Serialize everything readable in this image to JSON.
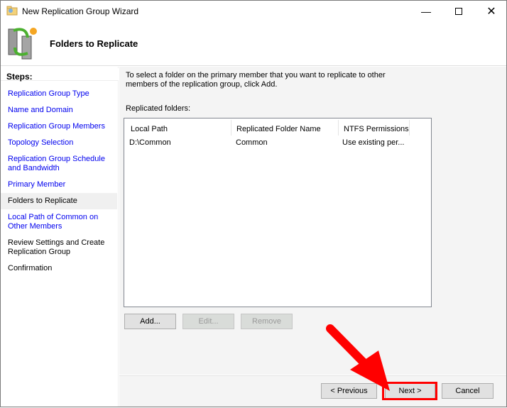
{
  "window": {
    "title": "New Replication Group Wizard",
    "controls": [
      "minimize",
      "maximize",
      "close"
    ]
  },
  "header": {
    "title": "Folders to Replicate",
    "icon": "replication-servers-icon"
  },
  "steps": {
    "heading": "Steps:",
    "items": [
      {
        "label": "Replication Group Type",
        "state": "link"
      },
      {
        "label": "Name and Domain",
        "state": "link"
      },
      {
        "label": "Replication Group Members",
        "state": "link"
      },
      {
        "label": "Topology Selection",
        "state": "link"
      },
      {
        "label": "Replication Group Schedule and Bandwidth",
        "state": "link"
      },
      {
        "label": "Primary Member",
        "state": "link"
      },
      {
        "label": "Folders to Replicate",
        "state": "current"
      },
      {
        "label": "Local Path of Common on Other Members",
        "state": "link"
      },
      {
        "label": "Review Settings and Create Replication Group",
        "state": "pending"
      },
      {
        "label": "Confirmation",
        "state": "pending"
      }
    ]
  },
  "main": {
    "description": "To select a folder on the primary member that you want to replicate to other members of the replication group, click Add.",
    "list_label": "Replicated folders:",
    "columns": [
      "Local Path",
      "Replicated Folder Name",
      "NTFS Permissions"
    ],
    "rows": [
      [
        "D:\\Common",
        "Common",
        "Use existing per..."
      ]
    ],
    "add": "Add...",
    "edit": "Edit...",
    "remove": "Remove"
  },
  "footer": {
    "previous": "< Previous",
    "next": "Next >",
    "cancel": "Cancel"
  },
  "annotation": {
    "color": "#ff0000",
    "highlight": "next-button"
  }
}
